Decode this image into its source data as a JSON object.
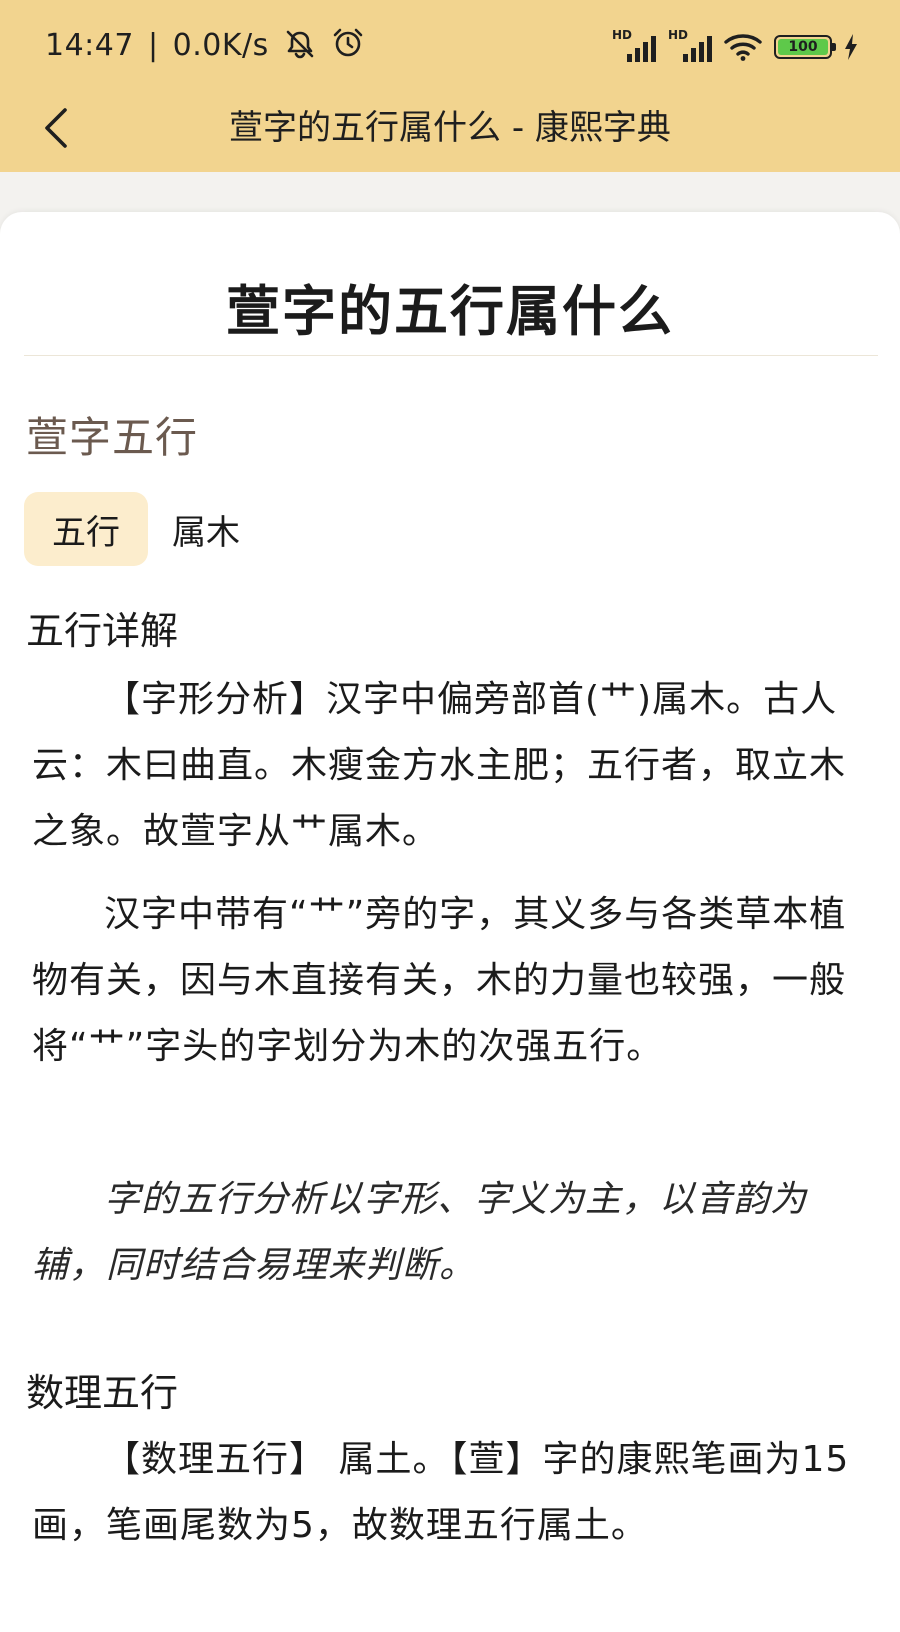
{
  "status_bar": {
    "time": "14:47",
    "speed": "0.0K/s",
    "hd1": "HD",
    "hd2": "HD",
    "battery": "100"
  },
  "app_bar": {
    "title": "萱字的五行属什么 - 康熙字典"
  },
  "content": {
    "page_title": "萱字的五行属什么",
    "section_title": "萱字五行",
    "element_label": "五行",
    "element_value": "属木",
    "detail_heading": "五行详解",
    "paragraphs": [
      "【字形分析】汉字中偏旁部首(艹)属木。古人云：木曰曲直。木瘦金方水主肥；五行者，取立木之象。故萱字从艹属木。",
      "汉字中带有“艹”旁的字，其义多与各类草本植物有关，因与木直接有关，木的力量也较强，一般将“艹”字头的字划分为木的次强五行。",
      "字的五行分析以字形、字义为主，以音韵为辅，同时结合易理来判断。"
    ],
    "number_heading": "数理五行",
    "number_paragraph": "【数理五行】 属土。【萱】字的康熙笔画为15画，笔画尾数为5，故数理五行属土。"
  },
  "colors": {
    "header_bg": "#f2d48f",
    "badge_bg": "#fcedcd",
    "section_title": "#6b5a4f",
    "battery_fill": "#5ec94a"
  },
  "icons": [
    "back-arrow-icon",
    "mute-icon",
    "alarm-icon",
    "signal-icon",
    "wifi-icon",
    "battery-icon",
    "charging-icon"
  ]
}
